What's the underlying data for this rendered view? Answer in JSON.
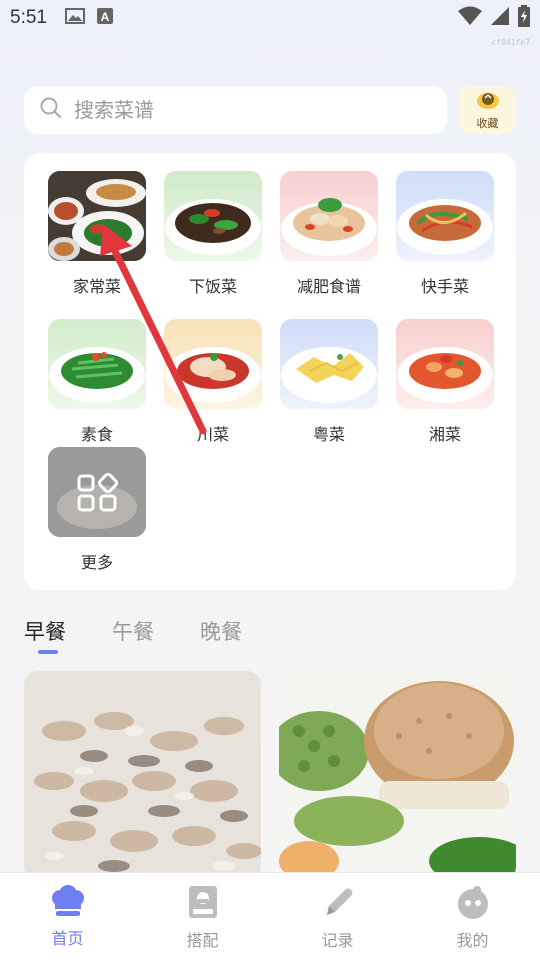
{
  "status_bar": {
    "time": "5:51",
    "icons": [
      "image-icon",
      "a-icon",
      "wifi-icon",
      "signal-icon",
      "battery-charging-icon"
    ]
  },
  "build_id": "cf041fe7",
  "search": {
    "placeholder": "搜索菜谱",
    "value": ""
  },
  "favorites": {
    "label": "收藏",
    "icon": "chef-favorites-icon"
  },
  "categories": [
    {
      "label": "家常菜",
      "icon": "home-dishes-image"
    },
    {
      "label": "下饭菜",
      "icon": "rice-dishes-image"
    },
    {
      "label": "减肥食谱",
      "icon": "diet-recipes-image"
    },
    {
      "label": "快手菜",
      "icon": "quick-dishes-image"
    },
    {
      "label": "素食",
      "icon": "vegetarian-image"
    },
    {
      "label": "川菜",
      "icon": "sichuan-image"
    },
    {
      "label": "粤菜",
      "icon": "cantonese-image"
    },
    {
      "label": "湘菜",
      "icon": "hunan-image"
    },
    {
      "label": "更多",
      "icon": "more-grid-icon"
    }
  ],
  "meal_tabs": [
    {
      "label": "早餐",
      "active": true
    },
    {
      "label": "午餐",
      "active": false
    },
    {
      "label": "晚餐",
      "active": false
    }
  ],
  "recipes": [
    {
      "image": "dried-shrimp-photo"
    },
    {
      "image": "sandwich-bitter-melon-photo"
    }
  ],
  "bottom_nav": [
    {
      "label": "首页",
      "icon": "chef-hat-icon",
      "active": true
    },
    {
      "label": "搭配",
      "icon": "recipe-book-icon",
      "active": false
    },
    {
      "label": "记录",
      "icon": "pencil-icon",
      "active": false
    },
    {
      "label": "我的",
      "icon": "profile-icon",
      "active": false
    }
  ],
  "colors": {
    "accent": "#6e7ff2",
    "tab_active": "#222222",
    "tab_inactive": "#999999",
    "favorites_bg": "#fdf6df",
    "annotation_arrow": "#e0373c"
  },
  "annotation": {
    "type": "arrow",
    "target": "家常菜"
  }
}
